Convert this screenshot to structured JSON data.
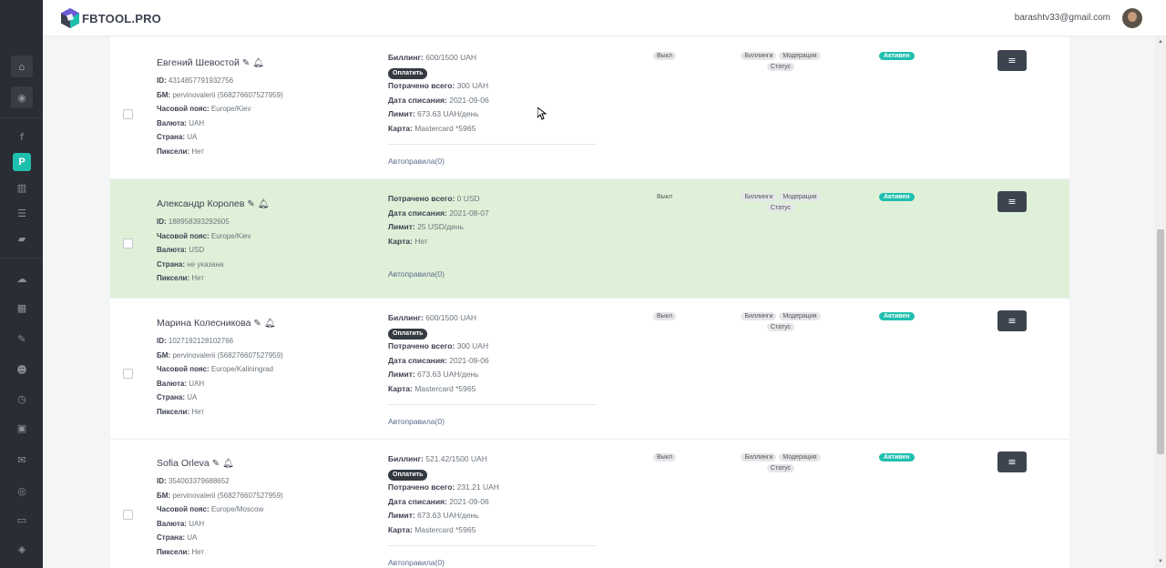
{
  "brand": {
    "logo_text": "FBTOOL.PRO",
    "accent": "#1fbfae"
  },
  "header": {
    "email": "barashtv33@gmail.com"
  },
  "sidebar": {
    "icons": [
      "home-icon",
      "user-circle-icon",
      "facebook-icon",
      "p-icon",
      "columns-icon",
      "list-icon",
      "folder-icon",
      "cloud-upload-icon",
      "chart-icon",
      "edit-icon",
      "users-icon",
      "clock-icon",
      "money-icon",
      "chat-icon",
      "profile-icon",
      "card-icon",
      "eye-icon"
    ],
    "active_label": "P"
  },
  "labels": {
    "id": "ID:",
    "bm": "БМ:",
    "timezone": "Часовой пояс:",
    "currency": "Валюта:",
    "country": "Страна:",
    "pixels": "Пиксели:",
    "billing": "Биллинг:",
    "pay": "Оплатить",
    "spent": "Потрачено всего:",
    "charge_date": "Дата списания:",
    "limit": "Лимит:",
    "card": "Карта:",
    "off": "Выкл",
    "tag_billing": "Биллинги",
    "tag_moderation": "Модерация",
    "tag_status": "Статус",
    "active": "Активен"
  },
  "accounts": [
    {
      "name": "Евгений Шевостой",
      "id": "4314857791932756",
      "bm": "pervinovalerii (568276607527959)",
      "timezone": "Europe/Kiev",
      "currency": "UAH",
      "country": "UA",
      "pixels": "Нет",
      "billing": "600/1500 UAH",
      "spent": "300 UAH",
      "charge_date": "2021-09-06",
      "limit": "673.63 UAH/день",
      "card": "Mastercard *5965",
      "autorules": "Автоправила(0)"
    },
    {
      "name": "Александр Королев",
      "id": "188958393292605",
      "timezone": "Europe/Kiev",
      "currency": "USD",
      "country": "не указана",
      "pixels": "Нет",
      "spent": "0 USD",
      "charge_date": "2021-08-07",
      "limit": "25 USD/день",
      "card": "Нет",
      "autorules": "Автоправила(0)"
    },
    {
      "name": "Марина Колесникова",
      "id": "1027192128102766",
      "bm": "pervinovalerii (568276607527959)",
      "timezone": "Europe/Kaliningrad",
      "currency": "UAH",
      "country": "UA",
      "pixels": "Нет",
      "billing": "600/1500 UAH",
      "spent": "300 UAH",
      "charge_date": "2021-09-06",
      "limit": "673.63 UAH/день",
      "card": "Mastercard *5965",
      "autorules": "Автоправила(0)"
    },
    {
      "name": "Sofia Orleva",
      "id": "354003379688652",
      "bm": "pervinovalerii (568276607527959)",
      "timezone": "Europe/Moscow",
      "currency": "UAH",
      "country": "UA",
      "pixels": "Нет",
      "billing": "521.42/1500 UAH",
      "spent": "231.21 UAH",
      "charge_date": "2021-09-06",
      "limit": "673.63 UAH/день",
      "card": "Mastercard *5965",
      "autorules": "Автоправила(0)"
    }
  ]
}
